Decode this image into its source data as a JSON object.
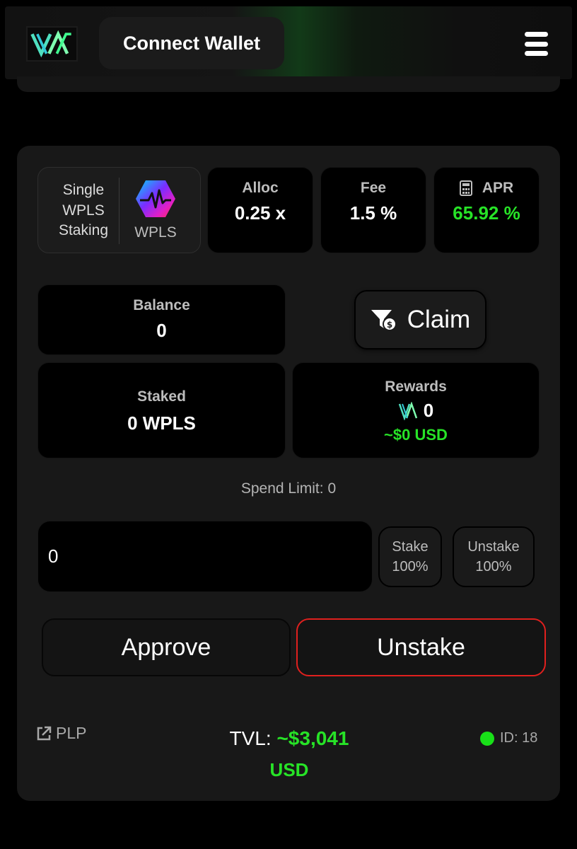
{
  "header": {
    "connect_label": "Connect Wallet"
  },
  "pool": {
    "name_lines": [
      "Single",
      "WPLS",
      "Staking"
    ],
    "token": "WPLS"
  },
  "stats": {
    "alloc_label": "Alloc",
    "alloc_value": "0.25 x",
    "fee_label": "Fee",
    "fee_value": "1.5 %",
    "apr_label": "APR",
    "apr_value": "65.92 %"
  },
  "balance": {
    "label": "Balance",
    "value": "0"
  },
  "claim": {
    "label": "Claim"
  },
  "staked": {
    "label": "Staked",
    "value": "0 WPLS"
  },
  "rewards": {
    "label": "Rewards",
    "value": "0",
    "usd": "~$0 USD"
  },
  "spend_limit": "Spend Limit: 0",
  "amount_input": {
    "value": "0"
  },
  "percent_buttons": {
    "stake_top": "Stake",
    "stake_bottom": "100%",
    "unstake_top": "Unstake",
    "unstake_bottom": "100%"
  },
  "actions": {
    "approve": "Approve",
    "unstake": "Unstake"
  },
  "footer": {
    "link_label": "PLP",
    "tvl_label": "TVL:",
    "tvl_value": "~$3,041",
    "tvl_unit": "USD",
    "id_label": "ID: 18"
  },
  "colors": {
    "accent_green": "#27e327",
    "unstake_border": "#e0201e",
    "logo_teal": "#5ff0d6"
  }
}
